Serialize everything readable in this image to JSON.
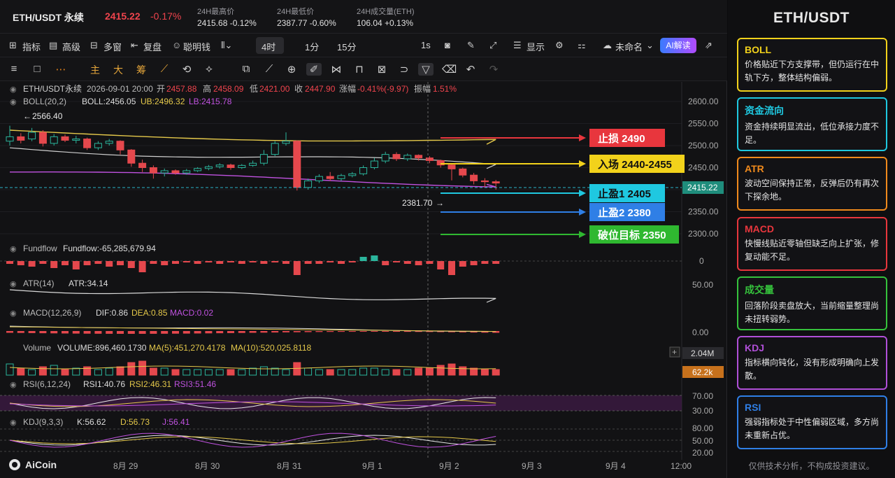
{
  "ticker": {
    "symbol": "ETH/USDT 永续",
    "price": "2415.22",
    "change": "-0.17%",
    "stats": [
      {
        "label": "24H最高价",
        "value": "2415.68  -0.12%"
      },
      {
        "label": "24H最低价",
        "value": "2387.77  -0.60%"
      },
      {
        "label": "24H成交量(ETH)",
        "value": "106.04  +0.13%"
      }
    ]
  },
  "toolbar": {
    "indicators": "指标",
    "advanced": "高级",
    "multi_window": "多窗",
    "replay": "复盘",
    "smart_money": "聪明钱",
    "timeframe": "4时",
    "tf_1m": "1分",
    "tf_15m": "15分",
    "tf_1s": "1s",
    "display": "显示",
    "unnamed": "未命名",
    "ai": "AI解读"
  },
  "drawing_toolbar": {
    "main": "主",
    "big": "大",
    "chip": "筹"
  },
  "chart_header": {
    "symbol": "ETH/USDT永续",
    "datetime": "2026-09-01 20:00",
    "open_label": "开",
    "open": "2457.88",
    "high_label": "高",
    "high": "2458.09",
    "low_label": "低",
    "low": "2421.00",
    "close_label": "收",
    "close": "2447.90",
    "change_label": "涨幅",
    "change": "-0.41%(-9.97)",
    "amp_label": "振幅",
    "amp": "1.51%"
  },
  "boll": {
    "name": "BOLL(20,2)",
    "mid": "BOLL:2456.05",
    "ub": "UB:2496.32",
    "lb": "LB:2415.78"
  },
  "annotations": {
    "high_marker": "2566.40",
    "low_marker": "2381.70",
    "current_price": "2415.22"
  },
  "trade_plan": [
    {
      "label": "止损 2490",
      "color": "#e8363d"
    },
    {
      "label": "入场 2440-2455",
      "color": "#f2d21b"
    },
    {
      "label": "止盈1 2405",
      "color": "#1fc8e0"
    },
    {
      "label": "止盈2 2380",
      "color": "#2f7fe6"
    },
    {
      "label": "破位目标 2350",
      "color": "#2fb830"
    }
  ],
  "price_axis": [
    "2600.00",
    "2550.00",
    "2500.00",
    "2450.00",
    "2400.00",
    "2350.00",
    "2300.00"
  ],
  "fundflow": {
    "name": "Fundflow",
    "value": "Fundflow:-65,285,679.94",
    "axis": "0"
  },
  "atr": {
    "name": "ATR(14)",
    "value": "ATR:34.14",
    "axis": "50.00"
  },
  "macd": {
    "name": "MACD(12,26,9)",
    "dif": "DIF:0.86",
    "dea": "DEA:0.85",
    "macd": "MACD:0.02",
    "axis": "0.00"
  },
  "volume": {
    "name": "Volume",
    "value": "VOLUME:896,460.1730",
    "ma5": "MA(5):451,270.4178",
    "ma10": "MA(10):520,025.8118",
    "axis_top": "2.04M",
    "axis_cur": "62.2k"
  },
  "rsi": {
    "name": "RSI(6,12,24)",
    "rsi1": "RSI1:40.76",
    "rsi2": "RSI2:46.31",
    "rsi3": "RSI3:51.46",
    "axis": [
      "70.00",
      "30.00"
    ]
  },
  "kdj": {
    "name": "KDJ(9,3,3)",
    "k": "K:56.62",
    "d": "D:56.73",
    "j": "J:56.41",
    "axis": [
      "80.00",
      "50.00",
      "20.00"
    ]
  },
  "time_axis": [
    "8月 29",
    "8月 30",
    "8月 31",
    "9月 1",
    "9月 2",
    "9月 3",
    "9月 4",
    "12:00"
  ],
  "brand": "AiCoin",
  "panel": {
    "title": "ETH/USDT",
    "cards": [
      {
        "title": "BOLL",
        "color": "#f2d21b",
        "body": "价格贴近下方支撑带，但仍运行在中轨下方，整体结构偏弱。"
      },
      {
        "title": "资金流向",
        "color": "#1fc8e0",
        "body": "资金持续明显流出，低位承接力度不足。"
      },
      {
        "title": "ATR",
        "color": "#f08a1c",
        "body": "波动空间保持正常，反弹后仍有再次下探余地。"
      },
      {
        "title": "MACD",
        "color": "#e8363d",
        "body": "快慢线贴近零轴但缺乏向上扩张，修复动能不足。"
      },
      {
        "title": "成交量",
        "color": "#35c23c",
        "body": "回落阶段卖盘放大，当前缩量整理尚未扭转弱势。"
      },
      {
        "title": "KDJ",
        "color": "#b04fd8",
        "body": "指标横向钝化，没有形成明确向上发散。"
      },
      {
        "title": "RSI",
        "color": "#2f7fe6",
        "body": "强弱指标处于中性偏弱区域，多方尚未重新占优。"
      }
    ],
    "footer": "仅供技术分析，不构成投资建议。"
  }
}
